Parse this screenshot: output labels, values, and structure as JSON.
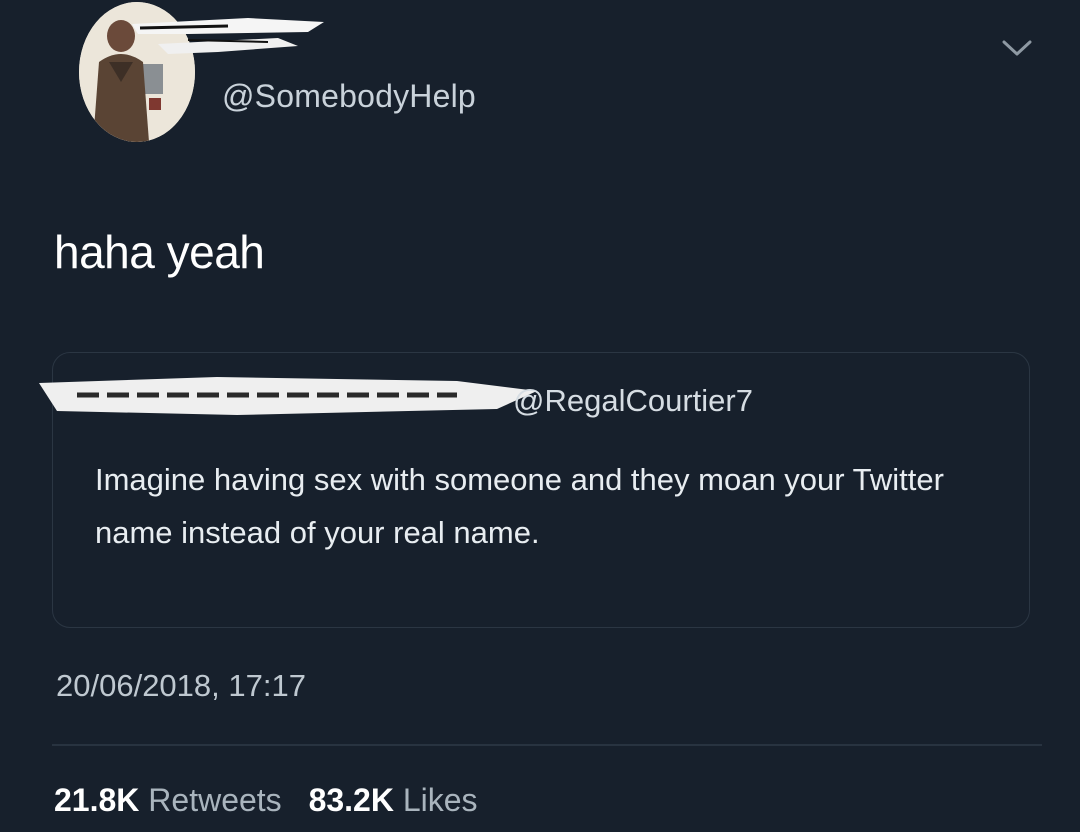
{
  "tweet": {
    "handle": "@SomebodyHelp",
    "text": "haha yeah",
    "timestamp": "20/06/2018, 17:17",
    "menu_icon": "chevron-down-icon"
  },
  "quoted_tweet": {
    "handle": "@RegalCourtier7",
    "text": "Imagine having sex with someone and they moan your Twitter name instead of your real name."
  },
  "stats": {
    "retweets_count": "21.8K",
    "retweets_label": "Retweets",
    "likes_count": "83.2K",
    "likes_label": "Likes"
  },
  "colors": {
    "background": "#17202c",
    "text": "#ffffff",
    "muted": "#a9b4bd",
    "border": "#2b3643"
  }
}
